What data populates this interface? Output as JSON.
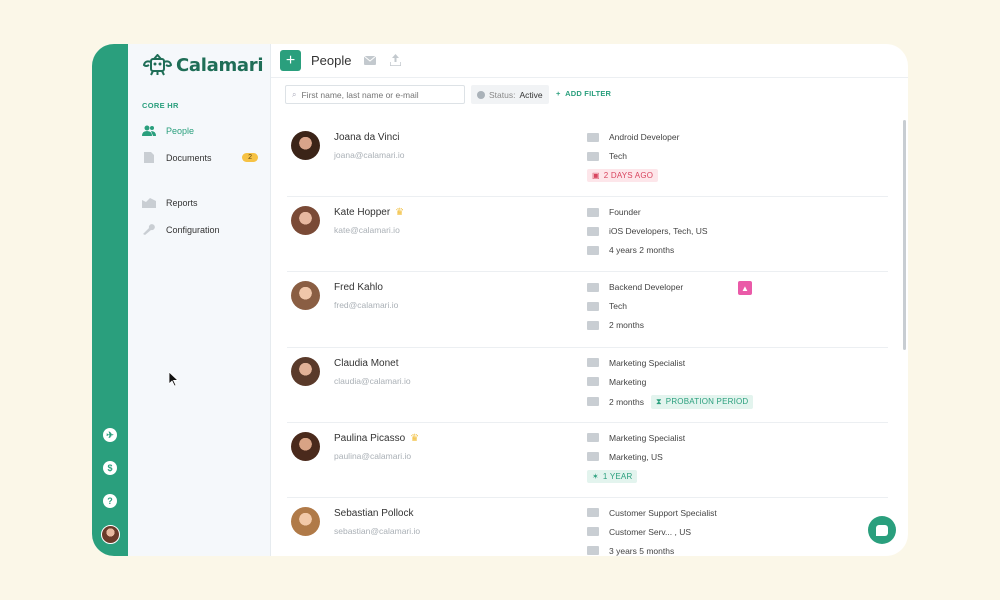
{
  "app": {
    "name": "Calamari",
    "accent": "#2a9f7d"
  },
  "sidebar": {
    "section_label": "CORE HR",
    "items": [
      {
        "label": "People",
        "icon": "people-icon",
        "active": true
      },
      {
        "label": "Documents",
        "icon": "documents-icon",
        "badge": "2"
      },
      {
        "label": "Reports",
        "icon": "reports-icon"
      },
      {
        "label": "Configuration",
        "icon": "wrench-icon"
      }
    ]
  },
  "rail": {
    "icons": [
      "plane-icon",
      "money-icon",
      "help-icon",
      "avatar"
    ]
  },
  "header": {
    "title": "People",
    "add_label": "+",
    "icons": [
      "mail-icon",
      "upload-icon"
    ]
  },
  "filters": {
    "search_placeholder": "First name, last name or e-mail",
    "status_label": "Status:",
    "status_value": "Active",
    "add_filter": "ADD FILTER"
  },
  "people": [
    {
      "name": "Joana da Vinci",
      "email": "joana@calamari.io",
      "crown": false,
      "position": "Android Developer",
      "team": "Tech",
      "tag": "2 DAYS AGO",
      "tag_color": "red"
    },
    {
      "name": "Kate Hopper",
      "email": "kate@calamari.io",
      "crown": true,
      "position": "Founder",
      "team": "iOS Developers, Tech, US",
      "tenure": "4 years 2 months"
    },
    {
      "name": "Fred Kahlo",
      "email": "fred@calamari.io",
      "crown": false,
      "position": "Backend Developer",
      "team": "Tech",
      "tenure": "2 months",
      "birthday": true
    },
    {
      "name": "Claudia Monet",
      "email": "claudia@calamari.io",
      "crown": false,
      "position": "Marketing Specialist",
      "team": "Marketing",
      "tenure": "2 months",
      "probation": "PROBATION PERIOD"
    },
    {
      "name": "Paulina Picasso",
      "email": "paulina@calamari.io",
      "crown": true,
      "position": "Marketing Specialist",
      "team": "Marketing, US",
      "tag": "1 YEAR",
      "tag_color": "green"
    },
    {
      "name": "Sebastian Pollock",
      "email": "sebastian@calamari.io",
      "crown": false,
      "position": "Customer Support Specialist",
      "team": "Customer Serv... , US",
      "tenure": "3 years 5 months"
    }
  ]
}
